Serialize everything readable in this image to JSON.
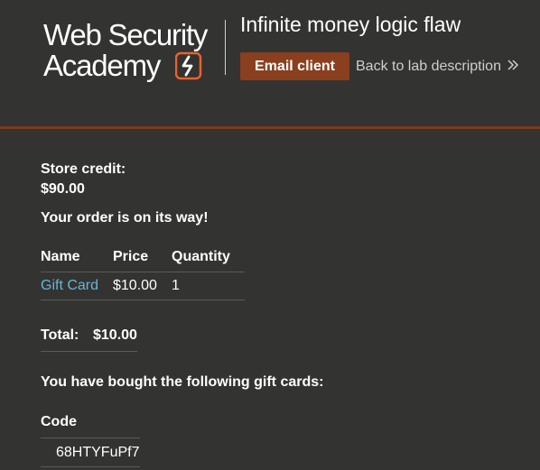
{
  "header": {
    "logo": {
      "line1": "Web Security",
      "line2": "Academy"
    },
    "lab_title": "Infinite money logic flaw",
    "email_button_label": "Email client",
    "back_link_label": "Back to lab description",
    "accent_color": "#8a3f1e"
  },
  "account": {
    "store_credit_label": "Store credit:",
    "store_credit_value": "$90.00"
  },
  "order": {
    "message": "Your order is on its way!",
    "columns": [
      "Name",
      "Price",
      "Quantity"
    ],
    "items": [
      {
        "name": "Gift Card",
        "price": "$10.00",
        "quantity": "1"
      }
    ],
    "total_label": "Total:",
    "total_value": "$10.00"
  },
  "gift_cards": {
    "message": "You have bought the following gift cards:",
    "column": "Code",
    "codes": [
      "68HTYFuPf7"
    ]
  }
}
